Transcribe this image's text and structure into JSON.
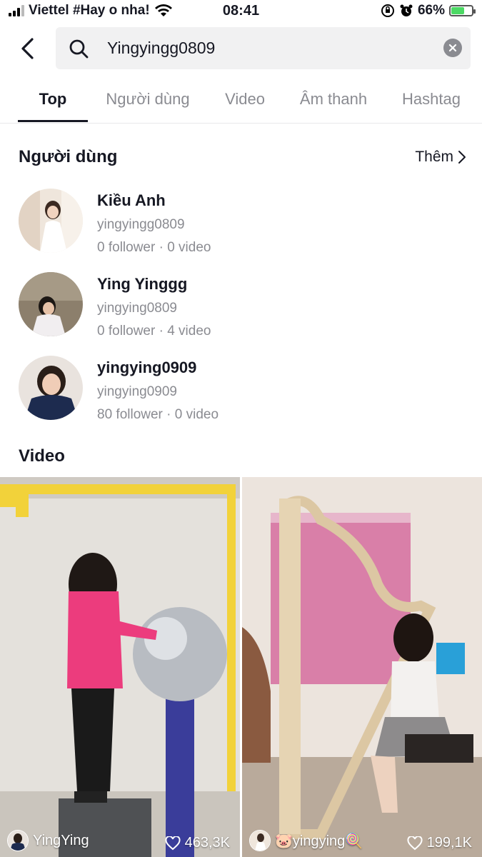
{
  "status_bar": {
    "carrier": "Viettel #Hay o nha!",
    "time": "08:41",
    "battery": "66%",
    "battery_level": 0.66
  },
  "search": {
    "query": "Yingyingg0809"
  },
  "tabs": [
    {
      "label": "Top"
    },
    {
      "label": "Người dùng"
    },
    {
      "label": "Video"
    },
    {
      "label": "Âm thanh"
    },
    {
      "label": "Hashtag"
    }
  ],
  "users_section": {
    "title": "Người dùng",
    "more_label": "Thêm",
    "users": [
      {
        "name": "Kiều Anh",
        "handle": "yingyingg0809",
        "stats": "0 follower · 0 video"
      },
      {
        "name": "Ying Yinggg",
        "handle": "yingying0809",
        "stats": "0 follower · 4 video"
      },
      {
        "name": "yingying0909",
        "handle": "yingying0909",
        "stats": "80 follower · 0 video"
      }
    ]
  },
  "videos_section": {
    "title": "Video",
    "videos": [
      {
        "author": "YingYing",
        "likes": "463,3K"
      },
      {
        "author": "🐷yingying🍭",
        "likes": "199,1K"
      }
    ]
  }
}
